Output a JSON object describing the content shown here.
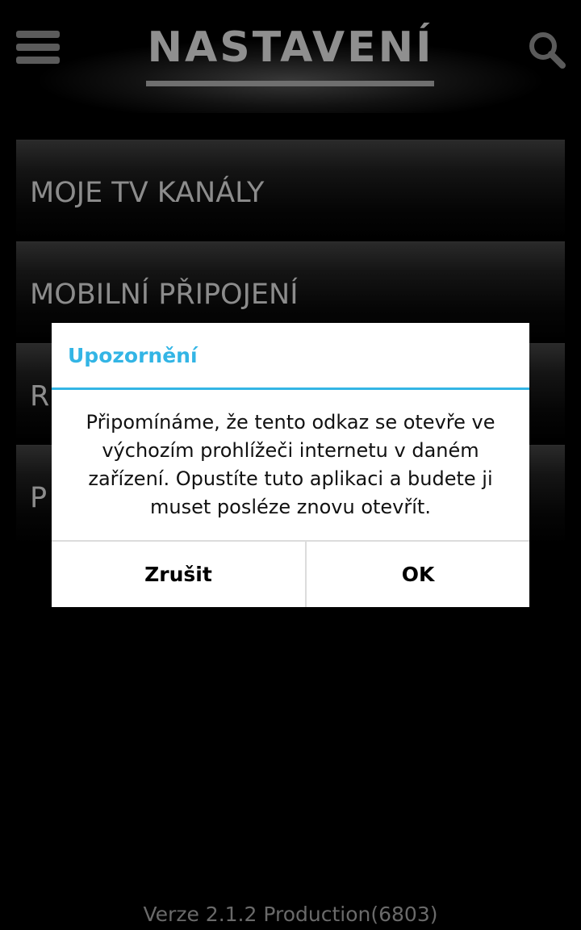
{
  "header": {
    "title": "NASTAVENÍ",
    "menu_icon": "hamburger-menu-icon",
    "search_icon": "search-icon"
  },
  "settings": {
    "items": [
      {
        "label": "MOJE TV KANÁLY"
      },
      {
        "label": "MOBILNÍ PŘIPOJENÍ"
      },
      {
        "label": "R"
      },
      {
        "label": "P"
      }
    ]
  },
  "dialog": {
    "title": "Upozornění",
    "message": "Připomínáme, že tento odkaz se otevře ve výchozím prohlížeči internetu v daném zařízení. Opustíte tuto aplikaci a budete ji muset posléze znovu otevřít.",
    "cancel_label": "Zrušit",
    "ok_label": "OK"
  },
  "footer": {
    "version": "Verze 2.1.2 Production(6803)"
  },
  "colors": {
    "background": "#000000",
    "accent": "#33b5e5",
    "text_gray": "#8c8c8c"
  }
}
